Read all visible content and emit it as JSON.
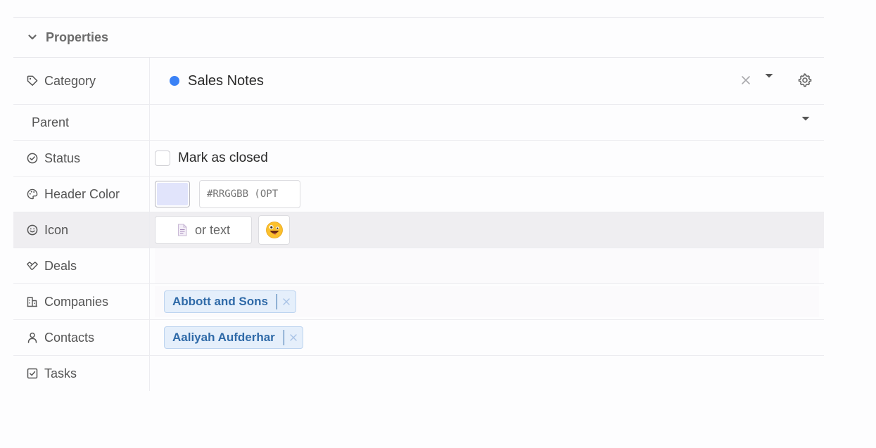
{
  "section": {
    "title": "Properties",
    "chevron_icon": "chevron-down-icon"
  },
  "rows": {
    "category": {
      "label": "Category",
      "icon": "tag-icon",
      "value": "Sales Notes",
      "dot_color": "#3b82f6"
    },
    "parent": {
      "label": "Parent"
    },
    "status": {
      "label": "Status",
      "icon": "check-circle-icon",
      "checkbox_label": "Mark as closed",
      "checked": false
    },
    "header_color": {
      "label": "Header Color",
      "icon": "palette-icon",
      "swatch_color": "#e1e4fb",
      "hex_placeholder": "#RRGGBB (OPT"
    },
    "icon": {
      "label": "Icon",
      "icon": "smiley-icon",
      "button_text": "or text",
      "emoji": "zany-face-emoji"
    },
    "deals": {
      "label": "Deals",
      "icon": "handshake-icon"
    },
    "companies": {
      "label": "Companies",
      "icon": "building-icon",
      "chips": [
        "Abbott and Sons"
      ]
    },
    "contacts": {
      "label": "Contacts",
      "icon": "person-icon",
      "chips": [
        "Aaliyah Aufderhar"
      ]
    },
    "tasks": {
      "label": "Tasks",
      "icon": "checkbox-icon"
    }
  },
  "colors": {
    "chip_text": "#2f6aa8",
    "chip_bg": "#e5effb",
    "selected_row_bg": "#efeef1"
  }
}
